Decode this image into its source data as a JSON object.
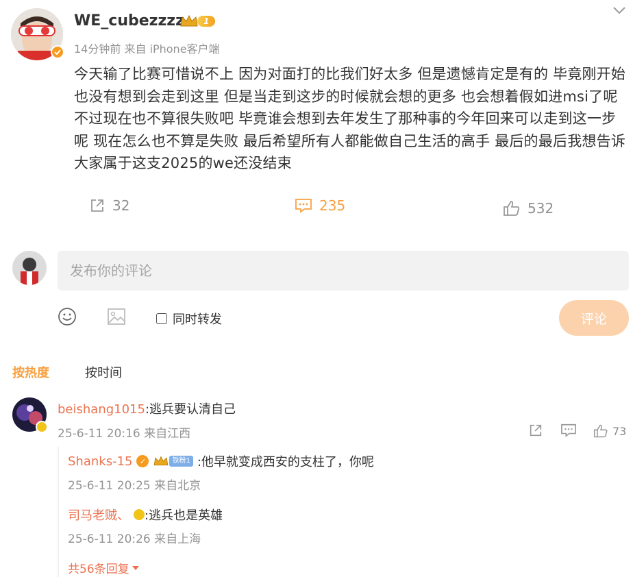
{
  "post": {
    "username": "WE_cubezzzz",
    "vip_level": "1",
    "meta": "14分钟前 来自 iPhone客户端",
    "text": "今天输了比赛可惜说不上 因为对面打的比我们好太多 但是遗憾肯定是有的 毕竟刚开始也没有想到会走到这里 但是当走到这步的时候就会想的更多 也会想着假如进msi了呢 不过现在也不算很失败吧 毕竟谁会想到去年发生了那种事的今年回来可以走到这一步呢 现在怎么也不算是失败 最后希望所有人都能做自己生活的高手 最后的最后我想告诉大家属于这支2025的we还没结束",
    "reposts": "32",
    "comments": "235",
    "likes": "532"
  },
  "composer": {
    "placeholder": "发布你的评论",
    "repost_label": "同时转发",
    "submit_label": "评论"
  },
  "sort": {
    "hot": "按热度",
    "time": "按时间"
  },
  "comment": {
    "username": "beishang1015",
    "text": ":逃兵要认清自己",
    "meta": "25-6-11 20:16 来自江西",
    "likes": "73"
  },
  "replies": [
    {
      "username": "Shanks-15",
      "fan_tag": "铁粉1",
      "text": ":他早就变成西安的支柱了，你呢",
      "meta": "25-6-11 20:25 来自北京"
    },
    {
      "username": "司马老贼、",
      "text": ":逃兵也是英雄",
      "meta": "25-6-11 20:26 来自上海"
    }
  ],
  "more_replies": "共56条回复",
  "colors": {
    "accent": "#eb7350",
    "active_orange": "#f7a040",
    "submit_bg": "#fbd2ac",
    "input_bg": "#f2f2f2"
  }
}
